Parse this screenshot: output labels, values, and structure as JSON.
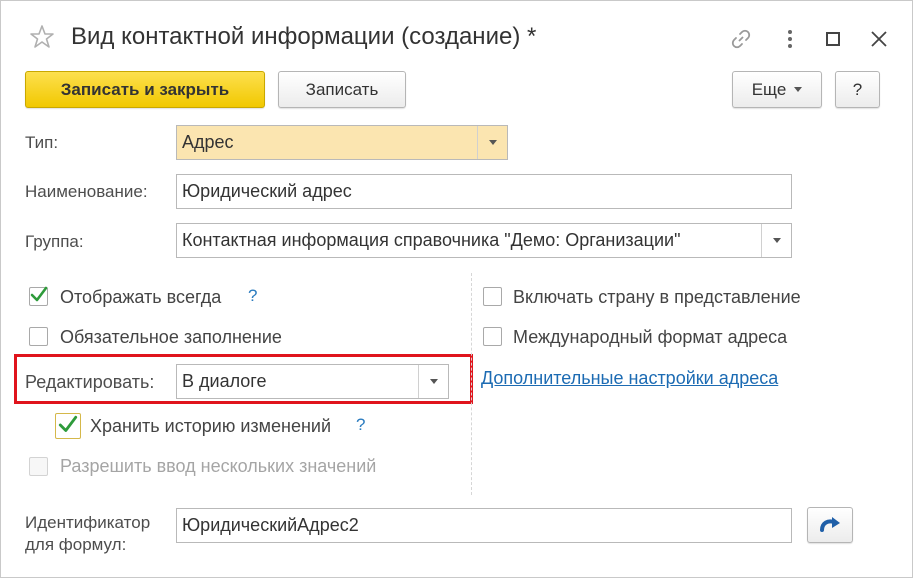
{
  "window": {
    "title": "Вид контактной информации (создание) *",
    "icons": [
      "star-icon",
      "link-icon",
      "more-vertical-icon",
      "maximize-icon",
      "close-icon"
    ]
  },
  "toolbar": {
    "save_close_label": "Записать и закрыть",
    "save_label": "Записать",
    "more_label": "Еще",
    "help_label": "?"
  },
  "form": {
    "type": {
      "label": "Тип:",
      "value": "Адрес"
    },
    "name": {
      "label": "Наименование:",
      "value": "Юридический адрес"
    },
    "group": {
      "label": "Группа:",
      "value": "Контактная информация справочника \"Демо: Организации\""
    },
    "edit_mode": {
      "label": "Редактировать:",
      "value": "В диалоге"
    },
    "identifier": {
      "label_line1": "Идентификатор",
      "label_line2": "для формул:",
      "value": "ЮридическийАдрес2"
    }
  },
  "checkboxes": {
    "always_show": {
      "label": "Отображать всегда",
      "checked": true,
      "help": "?"
    },
    "required": {
      "label": "Обязательное заполнение",
      "checked": false
    },
    "keep_history": {
      "label": "Хранить историю изменений",
      "checked": true,
      "help": "?"
    },
    "multiple_values": {
      "label": "Разрешить ввод нескольких значений",
      "checked": false,
      "disabled": true
    },
    "include_country": {
      "label": "Включать страну в представление",
      "checked": false
    },
    "intl_format": {
      "label": "Международный формат адреса",
      "checked": false
    }
  },
  "links": {
    "extra_settings": "Дополнительные настройки адреса"
  },
  "colors": {
    "primary_button": "#f4cd00",
    "highlight_field": "#fbe5b0",
    "link": "#1c6bb3",
    "help": "#2a7bbf",
    "check": "#2e9b3b",
    "annotation_frame": "#e0141c"
  }
}
